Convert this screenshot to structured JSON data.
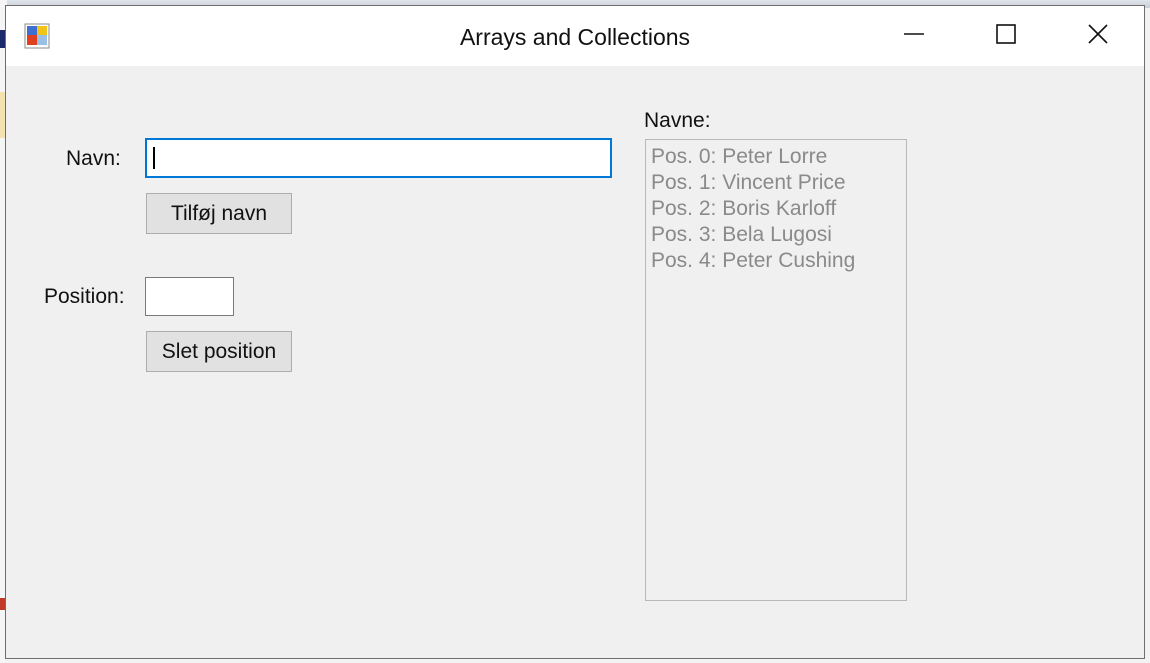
{
  "window": {
    "title": "Arrays and Collections"
  },
  "form": {
    "name_label": "Navn:",
    "name_value": "",
    "add_button": "Tilføj navn",
    "position_label": "Position:",
    "position_value": "",
    "delete_button": "Slet position"
  },
  "list": {
    "label": "Navne:",
    "items": [
      "Pos. 0: Peter Lorre",
      "Pos. 1: Vincent Price",
      "Pos. 2: Boris Karloff",
      "Pos. 3: Bela Lugosi",
      "Pos. 4: Peter Cushing"
    ]
  },
  "colors": {
    "focus_border": "#0078d7",
    "window_bg": "#f0f0f0",
    "disabled_text": "#8a8a8a"
  },
  "icons": {
    "app": "winforms-app-icon",
    "minimize": "minimize-icon",
    "maximize": "maximize-icon",
    "close": "close-icon"
  }
}
